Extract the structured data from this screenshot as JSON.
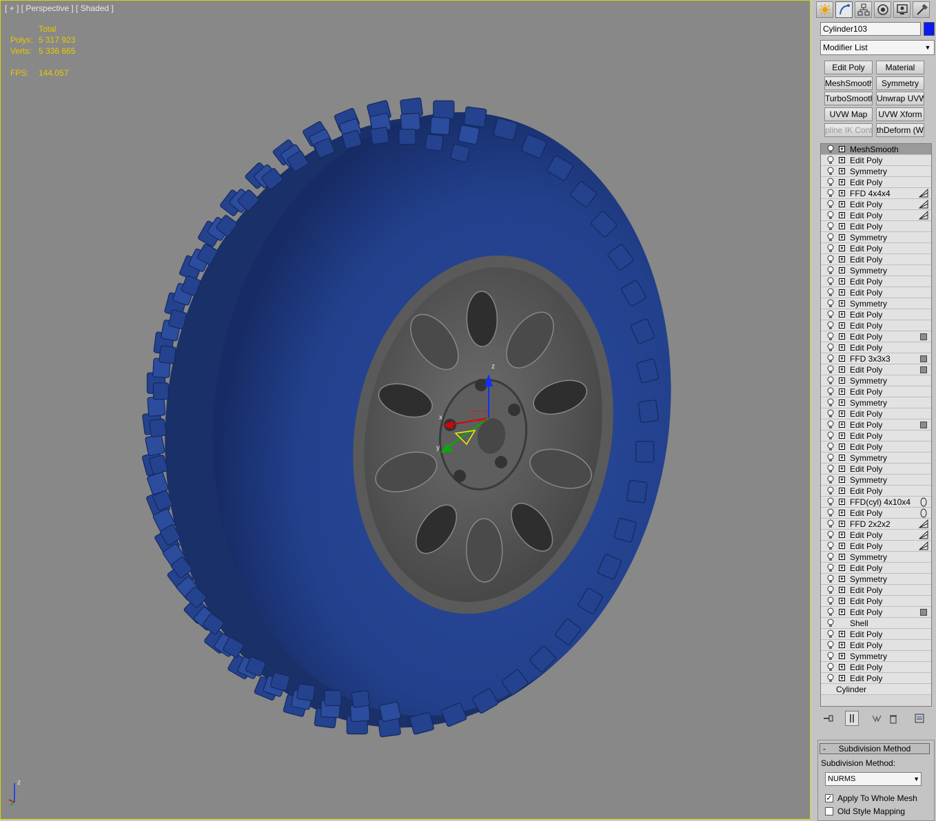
{
  "viewport": {
    "label": "[ + ] [ Perspective ] [ Shaded ]",
    "stats": {
      "total_label": "Total",
      "polys_label": "Polys:",
      "polys_value": "5 317 923",
      "verts_label": "Verts:",
      "verts_value": "5 336 665",
      "fps_label": "FPS:",
      "fps_value": "144.057"
    },
    "gizmo_labels": {
      "x": "x",
      "y": "y",
      "z": "z"
    },
    "corner_axis_label": "z"
  },
  "command_panel": {
    "tabs": [
      "create-icon",
      "modify-icon",
      "hierarchy-icon",
      "motion-icon",
      "display-icon",
      "utilities-icon"
    ],
    "object_name": "Cylinder103",
    "object_color": "#0a1af0",
    "modifier_list_label": "Modifier List",
    "quick_buttons": [
      [
        "Edit Poly",
        "Material"
      ],
      [
        "MeshSmooth",
        "Symmetry"
      ],
      [
        "TurboSmooth",
        "Unwrap UVW"
      ],
      [
        "UVW Map",
        "UVW Xform"
      ],
      [
        "pline IK Contro",
        "thDeform (WSI"
      ]
    ],
    "stack": [
      {
        "name": "MeshSmooth",
        "mark": "",
        "selected": true
      },
      {
        "name": "Edit Poly",
        "mark": ""
      },
      {
        "name": "Symmetry",
        "mark": ""
      },
      {
        "name": "Edit Poly",
        "mark": ""
      },
      {
        "name": "FFD 4x4x4",
        "mark": "tri"
      },
      {
        "name": "Edit Poly",
        "mark": "tri"
      },
      {
        "name": "Edit Poly",
        "mark": "tri"
      },
      {
        "name": "Edit Poly",
        "mark": ""
      },
      {
        "name": "Symmetry",
        "mark": ""
      },
      {
        "name": "Edit Poly",
        "mark": ""
      },
      {
        "name": "Edit Poly",
        "mark": ""
      },
      {
        "name": "Symmetry",
        "mark": ""
      },
      {
        "name": "Edit Poly",
        "mark": ""
      },
      {
        "name": "Edit Poly",
        "mark": ""
      },
      {
        "name": "Symmetry",
        "mark": ""
      },
      {
        "name": "Edit Poly",
        "mark": ""
      },
      {
        "name": "Edit Poly",
        "mark": ""
      },
      {
        "name": "Edit Poly",
        "mark": "sq"
      },
      {
        "name": "Edit Poly",
        "mark": ""
      },
      {
        "name": "FFD 3x3x3",
        "mark": "sq"
      },
      {
        "name": "Edit Poly",
        "mark": "sq"
      },
      {
        "name": "Symmetry",
        "mark": ""
      },
      {
        "name": "Edit Poly",
        "mark": ""
      },
      {
        "name": "Symmetry",
        "mark": ""
      },
      {
        "name": "Edit Poly",
        "mark": ""
      },
      {
        "name": "Edit Poly",
        "mark": "sq"
      },
      {
        "name": "Edit Poly",
        "mark": ""
      },
      {
        "name": "Edit Poly",
        "mark": ""
      },
      {
        "name": "Symmetry",
        "mark": ""
      },
      {
        "name": "Edit Poly",
        "mark": ""
      },
      {
        "name": "Symmetry",
        "mark": ""
      },
      {
        "name": "Edit Poly",
        "mark": ""
      },
      {
        "name": "FFD(cyl) 4x10x4",
        "mark": "cyl"
      },
      {
        "name": "Edit Poly",
        "mark": "cyl"
      },
      {
        "name": "FFD 2x2x2",
        "mark": "tri"
      },
      {
        "name": "Edit Poly",
        "mark": "tri"
      },
      {
        "name": "Edit Poly",
        "mark": "tri"
      },
      {
        "name": "Symmetry",
        "mark": ""
      },
      {
        "name": "Edit Poly",
        "mark": ""
      },
      {
        "name": "Symmetry",
        "mark": ""
      },
      {
        "name": "Edit Poly",
        "mark": ""
      },
      {
        "name": "Edit Poly",
        "mark": ""
      },
      {
        "name": "Edit Poly",
        "mark": "sq"
      },
      {
        "name": "Shell",
        "mark": "",
        "noplus": true
      },
      {
        "name": "Edit Poly",
        "mark": ""
      },
      {
        "name": "Edit Poly",
        "mark": ""
      },
      {
        "name": "Symmetry",
        "mark": ""
      },
      {
        "name": "Edit Poly",
        "mark": ""
      },
      {
        "name": "Edit Poly",
        "mark": ""
      },
      {
        "name": "Cylinder",
        "mark": "",
        "base": true
      }
    ],
    "stack_tools": [
      "pin-stack-icon",
      "show-end-result-icon",
      "make-unique-icon",
      "remove-modifier-icon",
      "configure-sets-icon"
    ],
    "rollout": {
      "title": "Subdivision Method",
      "collapse_symbol": "-",
      "method_label": "Subdivision Method:",
      "method_value": "NURMS",
      "options": [
        {
          "label": "Apply To Whole Mesh",
          "checked": true
        },
        {
          "label": "Old Style Mapping",
          "checked": false
        }
      ]
    }
  }
}
